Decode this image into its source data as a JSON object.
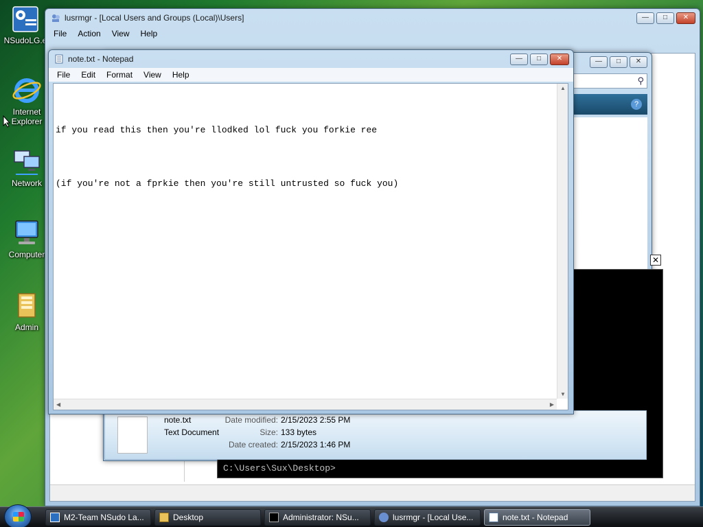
{
  "desktop": {
    "icons": [
      {
        "label": "NSudoLG.e"
      },
      {
        "label": "Internet Explorer"
      },
      {
        "label": "Network"
      },
      {
        "label": "Computer"
      },
      {
        "label": "Admin"
      }
    ]
  },
  "lusrmgr": {
    "title": "lusrmgr - [Local Users and Groups (Local)\\Users]",
    "menu": [
      "File",
      "Action",
      "View",
      "Help"
    ]
  },
  "notepad": {
    "title": "note.txt - Notepad",
    "menu": [
      "File",
      "Edit",
      "Format",
      "View",
      "Help"
    ],
    "lines": [
      "if you read this then you're llodked lol fuck you forkie ree",
      "(if you're not a fprkie then you're still untrusted so fuck you)"
    ]
  },
  "details_pane": {
    "file_name": "note.txt",
    "file_type": "Text Document",
    "date_modified_label": "Date modified:",
    "date_modified": "2/15/2023 2:55 PM",
    "size_label": "Size:",
    "size": "133 bytes",
    "date_created_label": "Date created:",
    "date_created": "2/15/2023 1:46 PM"
  },
  "console": {
    "prompt": "C:\\Users\\Sux\\Desktop>"
  },
  "taskbar": {
    "buttons": [
      {
        "label": "M2-Team NSudo La..."
      },
      {
        "label": "Desktop"
      },
      {
        "label": "Administrator: NSu..."
      },
      {
        "label": "lusrmgr - [Local Use..."
      },
      {
        "label": "note.txt - Notepad"
      }
    ]
  }
}
